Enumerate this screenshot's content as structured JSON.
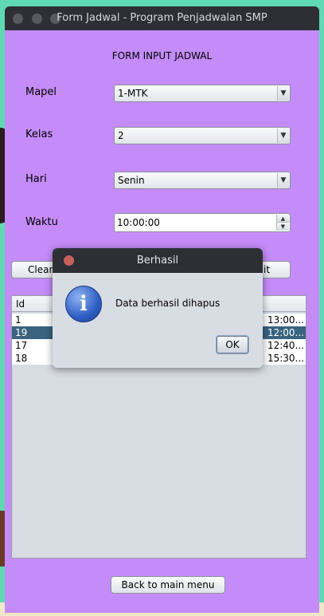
{
  "window": {
    "title": "Form Jadwal - Program Penjadwalan SMP"
  },
  "form": {
    "heading": "FORM INPUT JADWAL",
    "mapel": {
      "label": "Mapel",
      "value": "1-MTK"
    },
    "kelas": {
      "label": "Kelas",
      "value": "2"
    },
    "hari": {
      "label": "Hari",
      "value": "Senin"
    },
    "waktu": {
      "label": "Waktu",
      "value": "10:00:00"
    }
  },
  "buttons": {
    "clear": "Clear",
    "edit_partial": "it",
    "back": "Back to main menu"
  },
  "table": {
    "columns": [
      "Id"
    ],
    "rows": [
      {
        "id": "1",
        "time": "13:00...",
        "selected": false
      },
      {
        "id": "19",
        "time": "12:00...",
        "selected": true
      },
      {
        "id": "17",
        "time": "12:40...",
        "selected": false
      },
      {
        "id": "18",
        "time": "15:30...",
        "selected": false
      }
    ]
  },
  "dialog": {
    "title": "Berhasil",
    "message": "Data berhasil dihapus",
    "ok": "OK",
    "icon": "info-icon"
  },
  "colors": {
    "window_bg": "#c48cf8",
    "titlebar": "#2d2f35",
    "selected_row": "#39637f"
  }
}
